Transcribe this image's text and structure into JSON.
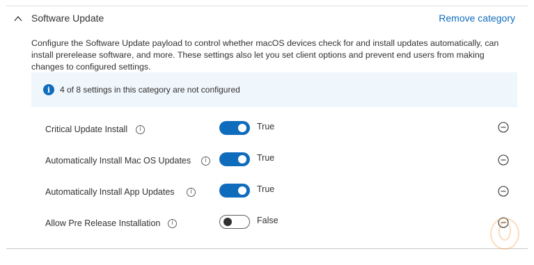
{
  "section": {
    "title": "Software Update",
    "remove_label": "Remove category",
    "description": "Configure the Software Update payload to control whether macOS devices check for and install updates automatically, can install prerelease software, and more. These settings also let you set client options and prevent end users from making changes to configured settings.",
    "info_message": "4 of 8 settings in this category are not configured"
  },
  "settings": [
    {
      "label": "Critical Update Install",
      "value": "True",
      "state": "on"
    },
    {
      "label": "Automatically Install Mac OS Updates",
      "value": "True",
      "state": "on"
    },
    {
      "label": "Automatically Install App Updates",
      "value": "True",
      "state": "on"
    },
    {
      "label": "Allow Pre Release Installation",
      "value": "False",
      "state": "off"
    }
  ],
  "colors": {
    "accent": "#0f6cbd",
    "info_background": "#eff6fc",
    "text": "#323130"
  },
  "icons": [
    "chevron-up-icon",
    "info-icon",
    "help-icon",
    "remove-circle-icon"
  ]
}
